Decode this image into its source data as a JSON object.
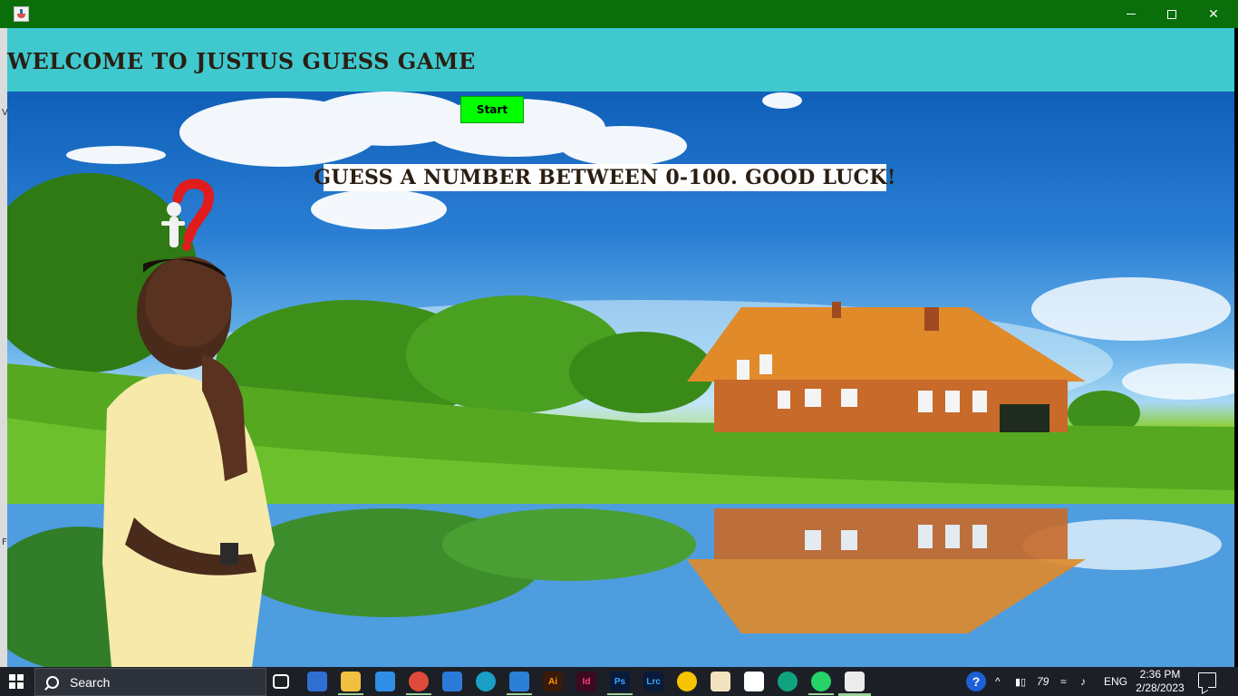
{
  "window": {
    "icon": "java-cup-icon",
    "controls": {
      "minimize": "minimize",
      "maximize": "maximize",
      "close": "✕"
    }
  },
  "left_strip": {
    "glyph_top": "V",
    "glyph_bottom": "F"
  },
  "header": {
    "title": "Welcome to Justus Guess Game"
  },
  "main": {
    "start_button": "Start",
    "instruction": "Guess a number between 0-100. Good Luck!"
  },
  "taskbar": {
    "search_label": "Search",
    "apps": [
      {
        "name": "task-view",
        "label": ""
      },
      {
        "name": "store",
        "label": ""
      },
      {
        "name": "file-explorer",
        "label": ""
      },
      {
        "name": "mail",
        "label": ""
      },
      {
        "name": "chrome",
        "label": ""
      },
      {
        "name": "app-blue",
        "label": ""
      },
      {
        "name": "edge",
        "label": ""
      },
      {
        "name": "vscode",
        "label": ""
      },
      {
        "name": "illustrator",
        "label": "Ai"
      },
      {
        "name": "indesign",
        "label": "Id"
      },
      {
        "name": "photoshop",
        "label": "Ps"
      },
      {
        "name": "lightroom-classic",
        "label": "Lrc"
      },
      {
        "name": "norton",
        "label": ""
      },
      {
        "name": "app-orange",
        "label": ""
      },
      {
        "name": "app-white",
        "label": ""
      },
      {
        "name": "chatgpt",
        "label": ""
      },
      {
        "name": "whatsapp",
        "label": ""
      },
      {
        "name": "java-app",
        "label": ""
      }
    ],
    "tray": {
      "battery_label": "79",
      "language": "ENG",
      "time": "2:36 PM",
      "date": "2/28/2023"
    }
  },
  "colors": {
    "titlebar": "#0a6e0a",
    "header": "#3fc9cf",
    "start_button": "#00ff00",
    "taskbar": "#1c1f26"
  }
}
